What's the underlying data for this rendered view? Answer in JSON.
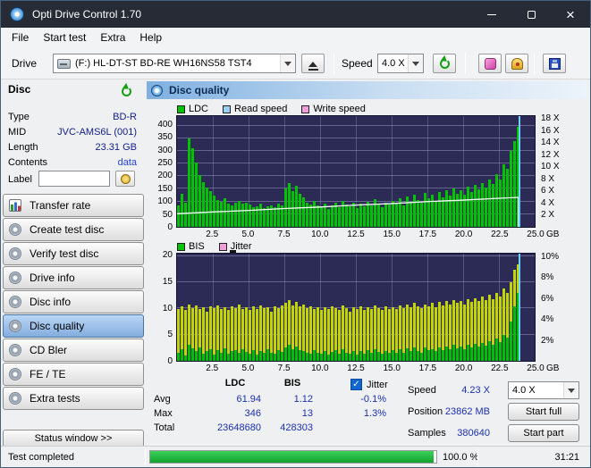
{
  "titlebar": {
    "title": "Opti Drive Control 1.70"
  },
  "menubar": {
    "items": [
      "File",
      "Start test",
      "Extra",
      "Help"
    ]
  },
  "toolbar": {
    "drive_label": "Drive",
    "drive_value": "(F:)  HL-DT-ST BD-RE  WH16NS58 TST4",
    "speed_label": "Speed",
    "speed_value": "4.0 X"
  },
  "disc_panel": {
    "title": "Disc",
    "fields": [
      {
        "label": "Type",
        "value": "BD-R"
      },
      {
        "label": "MID",
        "value": "JVC-AMS6L (001)"
      },
      {
        "label": "Length",
        "value": "23.31 GB"
      },
      {
        "label": "Contents",
        "value": "data",
        "link": true
      }
    ],
    "label_field": "Label",
    "label_value": ""
  },
  "sidebar": {
    "items": [
      "Transfer rate",
      "Create test disc",
      "Verify test disc",
      "Drive info",
      "Disc info",
      "Disc quality",
      "CD Bler",
      "FE / TE",
      "Extra tests"
    ],
    "active_index": 5,
    "status_button": "Status window >>"
  },
  "main_header": "Disc quality",
  "results": {
    "col_ldc": "LDC",
    "col_bis": "BIS",
    "rows": [
      {
        "label": "Avg",
        "ldc": "61.94",
        "bis": "1.12",
        "jitter": "-0.1%"
      },
      {
        "label": "Max",
        "ldc": "346",
        "bis": "13",
        "jitter": "1.3%"
      },
      {
        "label": "Total",
        "ldc": "23648680",
        "bis": "428303",
        "jitter": ""
      }
    ],
    "jitter_checkbox": "Jitter",
    "speed_label": "Speed",
    "speed_value": "4.23 X",
    "speed_combo": "4.0 X",
    "position_label": "Position",
    "position_value": "23862 MB",
    "samples_label": "Samples",
    "samples_value": "380640",
    "start_full": "Start full",
    "start_part": "Start part"
  },
  "statusbar": {
    "status": "Test completed",
    "percent": "100.0 %",
    "time": "31:21"
  },
  "chart_data": [
    {
      "type": "bar",
      "title": "LDC errors with read speed overlay",
      "legend": [
        {
          "label": "LDC",
          "color": "#00c300"
        },
        {
          "label": "Read speed",
          "color": "#9ad0f5"
        },
        {
          "label": "Write speed",
          "color": "#f0a0d8"
        }
      ],
      "x_ticks": [
        "2.5",
        "5.0",
        "7.5",
        "10.0",
        "12.5",
        "15.0",
        "17.5",
        "20.0",
        "22.5",
        "25.0"
      ],
      "x_unit": "GB",
      "x_max_gb": 25,
      "left_axis": {
        "ticks": [
          400,
          350,
          300,
          250,
          200,
          150,
          100,
          50,
          0
        ],
        "max": 437
      },
      "right_axis": {
        "ticks": [
          18,
          16,
          14,
          12,
          10,
          8,
          6,
          4,
          2
        ],
        "suffix": " X",
        "max": 18.6
      },
      "series": [
        {
          "name": "LDC",
          "axis": "left",
          "color": "#00c300",
          "values": [
            85,
            130,
            95,
            350,
            310,
            255,
            205,
            175,
            155,
            140,
            125,
            105,
            98,
            112,
            92,
            86,
            96,
            104,
            90,
            94,
            88,
            76,
            82,
            90,
            74,
            80,
            86,
            78,
            92,
            84,
            150,
            172,
            142,
            162,
            132,
            118,
            96,
            88,
            102,
            84,
            78,
            92,
            70,
            86,
            94,
            76,
            104,
            88,
            80,
            96,
            74,
            90,
            82,
            98,
            86,
            110,
            92,
            78,
            96,
            88,
            104,
            94,
            112,
            86,
            120,
            98,
            128,
            106,
            96,
            134,
            112,
            126,
            104,
            138,
            118,
            146,
            124,
            152,
            132,
            144,
            126,
            158,
            136,
            164,
            148,
            172,
            156,
            188,
            168,
            208,
            186,
            248,
            228,
            298,
            338,
            396,
            0,
            0,
            0,
            0
          ]
        }
      ],
      "line": {
        "name": "Read speed",
        "color": "#ffffff",
        "x_gb": [
          0,
          2.5,
          5,
          7.5,
          10,
          12.5,
          15,
          17.5,
          20,
          22.5,
          23.86
        ],
        "speed": [
          2.2,
          2.5,
          2.76,
          3.08,
          3.33,
          3.66,
          3.91,
          4.24,
          4.49,
          4.8,
          4.95
        ]
      },
      "cursor": {
        "gb": 23.86,
        "color": "#6fd0ff"
      }
    },
    {
      "type": "bar",
      "title": "BIS errors with jitter overlay",
      "legend": [
        {
          "label": "BIS",
          "color": "#00c300"
        },
        {
          "label": "Jitter",
          "color": "#f0a0d8"
        }
      ],
      "x_ticks": [
        "2.5",
        "5.0",
        "7.5",
        "10.0",
        "12.5",
        "15.0",
        "17.5",
        "20.0",
        "22.5",
        "25.0"
      ],
      "x_unit": "GB",
      "x_max_gb": 25,
      "left_axis": {
        "ticks": [
          20,
          15,
          10,
          5,
          0
        ],
        "max": 20.5
      },
      "right_axis": {
        "ticks": [
          10,
          8,
          6,
          4,
          2
        ],
        "suffix": "%",
        "max": 10.4
      },
      "series": [
        {
          "name": "Jitter",
          "axis": "right",
          "color": "#c3d400",
          "values": [
            5.0,
            5.3,
            4.9,
            5.5,
            5.1,
            5.4,
            5.0,
            5.2,
            4.8,
            5.3,
            5.1,
            5.4,
            5.0,
            5.2,
            4.9,
            5.3,
            5.1,
            5.5,
            5.0,
            5.2,
            4.9,
            5.3,
            5.0,
            5.4,
            5.1,
            5.2,
            4.8,
            5.3,
            5.1,
            5.4,
            5.6,
            5.9,
            5.4,
            5.7,
            5.3,
            5.5,
            5.1,
            5.3,
            5.0,
            5.2,
            4.9,
            5.2,
            5.0,
            5.3,
            5.1,
            4.9,
            5.4,
            5.1,
            4.8,
            5.2,
            5.0,
            5.3,
            4.9,
            5.2,
            5.0,
            5.4,
            5.1,
            4.9,
            5.3,
            5.0,
            5.2,
            5.0,
            5.4,
            5.1,
            5.5,
            5.2,
            5.6,
            5.3,
            5.1,
            5.5,
            5.3,
            5.6,
            5.2,
            5.7,
            5.4,
            5.8,
            5.5,
            5.9,
            5.6,
            5.8,
            5.5,
            6.0,
            5.7,
            6.1,
            5.8,
            6.2,
            5.9,
            6.4,
            6.0,
            6.6,
            6.2,
            7.0,
            6.6,
            7.6,
            8.8,
            9.4,
            0,
            0,
            0,
            0
          ]
        },
        {
          "name": "BIS",
          "axis": "left",
          "color": "#00bf00",
          "values": [
            1.5,
            2.2,
            1.1,
            3.0,
            2.4,
            1.8,
            2.6,
            1.4,
            1.9,
            2.2,
            1.2,
            2.0,
            1.6,
            2.4,
            1.3,
            1.8,
            2.1,
            1.5,
            2.3,
            1.7,
            1.4,
            2.0,
            1.2,
            1.8,
            1.5,
            2.2,
            1.6,
            1.3,
            2.0,
            1.7,
            2.6,
            3.1,
            2.3,
            2.8,
            2.1,
            1.9,
            1.6,
            1.4,
            2.0,
            1.5,
            1.3,
            1.9,
            1.2,
            1.7,
            2.1,
            1.4,
            2.2,
            1.6,
            1.3,
            1.9,
            1.2,
            1.8,
            1.4,
            2.0,
            1.6,
            2.3,
            1.7,
            1.3,
            1.9,
            1.5,
            2.0,
            1.6,
            2.2,
            1.5,
            2.4,
            1.8,
            2.6,
            1.9,
            1.6,
            2.5,
            2.0,
            2.3,
            1.8,
            2.6,
            2.1,
            2.8,
            2.2,
            3.0,
            2.4,
            2.7,
            2.3,
            3.0,
            2.5,
            3.2,
            2.7,
            3.4,
            2.9,
            3.7,
            3.1,
            4.2,
            3.6,
            5.0,
            4.4,
            7.5,
            10.5,
            13.0,
            0,
            0,
            0,
            0
          ]
        }
      ],
      "cursor": {
        "gb": 23.86,
        "color": "#6fd0ff"
      }
    }
  ]
}
